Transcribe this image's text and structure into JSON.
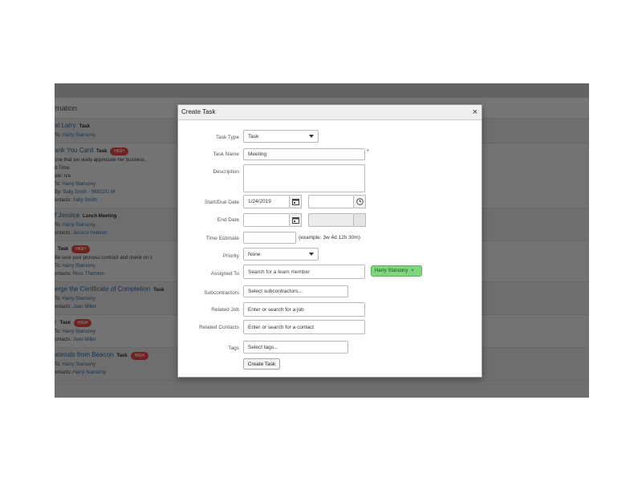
{
  "background": {
    "section_heading": "rmation",
    "items": [
      {
        "title": "al Larry",
        "type": "Task",
        "badge": "",
        "lines": [
          {
            "prefix": "To: ",
            "link": "Harry Stansony"
          }
        ]
      },
      {
        "title": "ank You Card",
        "type": "Task",
        "badge": "HIGH",
        "lines": [
          {
            "prefix": "one that we really appreciate her business.",
            "link": ""
          },
          {
            "prefix": "d Time:",
            "link": ""
          },
          {
            "prefix": "ate: n/a",
            "link": ""
          },
          {
            "prefix": "To: ",
            "link": "Harry Stansony"
          },
          {
            "prefix": "By: ",
            "link": "Sally Smith - 9681101 M"
          },
          {
            "prefix": "ontacts: ",
            "link": "Sally Smith"
          }
        ]
      },
      {
        "title": "f Jessica",
        "type": "Lunch Meeting",
        "badge": "",
        "lines": [
          {
            "prefix": "To: ",
            "link": "Harry Stansony"
          },
          {
            "prefix": "ontacts: ",
            "link": "Jessica Hudson"
          }
        ]
      },
      {
        "title": "",
        "type": "Task",
        "badge": "HIGH",
        "lines": [
          {
            "prefix": "Be sure your process contract and check on s",
            "link": ""
          },
          {
            "prefix": "To: ",
            "link": "Harry Stansony"
          },
          {
            "prefix": "ontacts: ",
            "link": "Ross Thornton"
          }
        ]
      },
      {
        "title": "erge the Certificate of Completion",
        "type": "Task",
        "badge": "",
        "lines": [
          {
            "prefix": "To: ",
            "link": "Harry Stansony"
          },
          {
            "prefix": "ontacts: ",
            "link": "Jean Miller"
          }
        ]
      },
      {
        "title": "r",
        "type": "Task",
        "badge": "HIGH",
        "lines": [
          {
            "prefix": "To: ",
            "link": "Harry Stansony"
          },
          {
            "prefix": "ontacts: ",
            "link": "Jean Miller"
          }
        ]
      },
      {
        "title": "aterials from Beacon",
        "type": "Task",
        "badge": "HIGH",
        "lines": [
          {
            "prefix": "To: ",
            "link": "Harry Stansony"
          },
          {
            "prefix": "ontacts: ",
            "link": "Harry Stansony"
          }
        ]
      }
    ]
  },
  "modal": {
    "title": "Create Task",
    "close_icon": "×",
    "fields": {
      "task_type": {
        "label": "Task Type",
        "value": "Task"
      },
      "task_name": {
        "label": "Task Name",
        "value": "Meeting",
        "required_mark": "*"
      },
      "description": {
        "label": "Description",
        "value": ""
      },
      "start_due_date": {
        "label": "Start/Due Date",
        "value": "1/24/2019",
        "time_value": ""
      },
      "end_date": {
        "label": "End Date",
        "value": ""
      },
      "time_estimate": {
        "label": "Time Estimate",
        "value": "",
        "hint": "(example: 3w 4d 12h 30m)"
      },
      "priority": {
        "label": "Priority",
        "value": "None"
      },
      "assigned_to": {
        "label": "Assigned To",
        "placeholder": "Search for a team member",
        "chip": "Harry Stansony",
        "chip_remove": "×"
      },
      "subcontractors": {
        "label": "Subcontractors",
        "placeholder": "Select subcontractors..."
      },
      "related_job": {
        "label": "Related Job",
        "placeholder": "Enter or search for a job"
      },
      "related_contacts": {
        "label": "Related Contacts",
        "placeholder": "Enter or search for a contact"
      },
      "tags": {
        "label": "Tags",
        "placeholder": "Select tags..."
      }
    },
    "submit_label": "Create Task"
  },
  "icons": [
    "calendar-icon",
    "clock-icon",
    "close-icon",
    "chevron-down-icon"
  ],
  "colors": {
    "badge_high": "#c9413b",
    "chip_green": "#7fd67f",
    "link_blue": "#2a5d91"
  }
}
